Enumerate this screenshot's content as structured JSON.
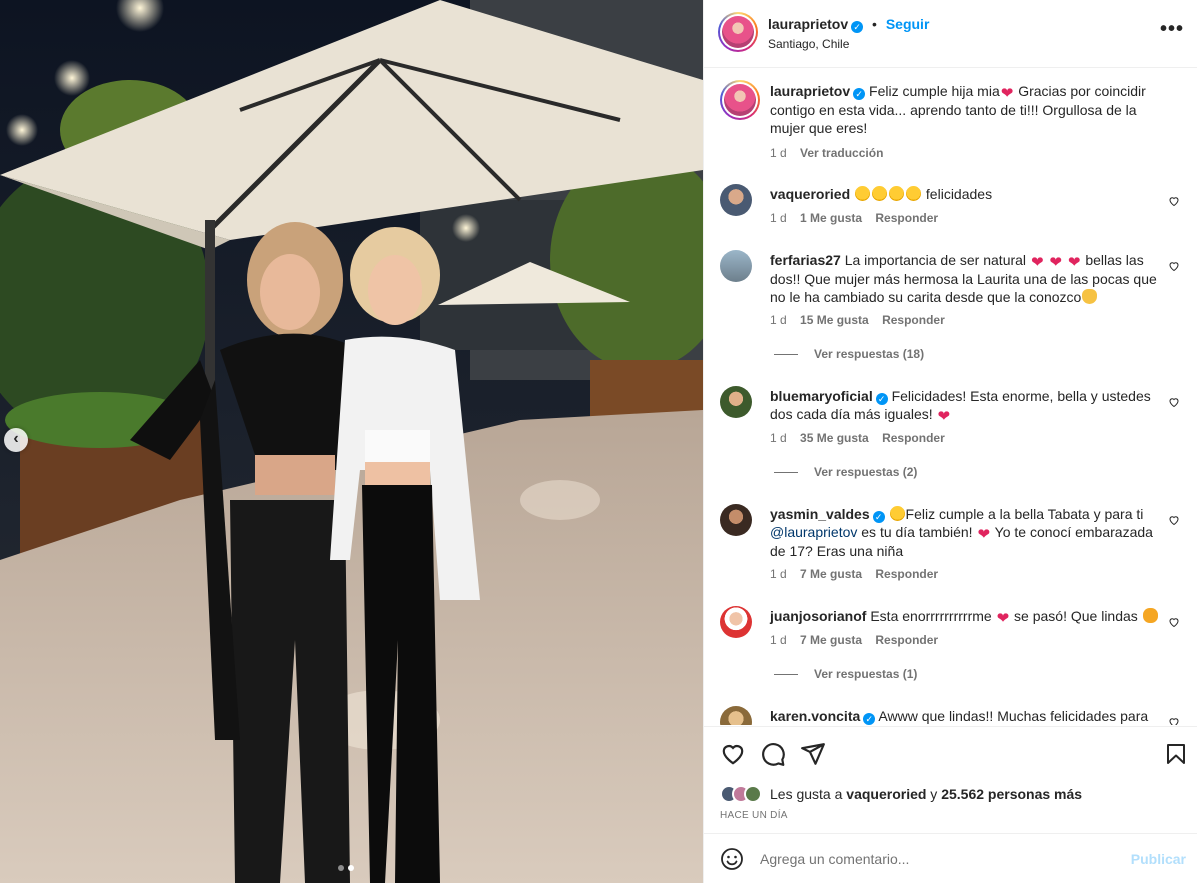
{
  "post_author": {
    "username": "lauraprietov",
    "follow_label": "Seguir",
    "location": "Santiago, Chile",
    "more_label": "•••"
  },
  "caption": {
    "username": "lauraprietov",
    "text_before_emoji": "Feliz cumple hija mia",
    "text_after_emoji": " Gracias por coincidir contigo en esta vida... aprendo tanto de ti!!! Orgullosa de la mujer que eres!",
    "time": "1 d",
    "translate_label": "Ver traducción"
  },
  "comments": [
    {
      "username": "vaqueroried",
      "text": " felicidades",
      "time": "1 d",
      "likes": "1 Me gusta",
      "reply_label": "Responder"
    },
    {
      "username": "ferfarias27",
      "text_a": "La importancia de ser natural ",
      "text_b": " bellas las dos!! Que mujer más hermosa la Laurita una de las pocas que no le ha cambiado su carita desde que la conozco",
      "time": "1 d",
      "likes": "15 Me gusta",
      "reply_label": "Responder",
      "replies_label": "Ver respuestas (18)"
    },
    {
      "username": "bluemaryoficial",
      "text": "Felicidades! Esta enorme, bella y ustedes dos cada día más iguales! ",
      "time": "1 d",
      "likes": "35 Me gusta",
      "reply_label": "Responder",
      "replies_label": "Ver respuestas (2)"
    },
    {
      "username": "yasmin_valdes",
      "text_a": "Feliz cumple a la bella Tabata y para ti ",
      "mention": "@lauraprietov",
      "text_b": " es tu día también! ",
      "text_c": " Yo te conocí embarazada de 17? Eras una niña",
      "time": "1 d",
      "likes": "7 Me gusta",
      "reply_label": "Responder"
    },
    {
      "username": "juanjosorianof",
      "text_a": "Esta enorrrrrrrrrrme ",
      "text_b": " se pasó! Que lindas ",
      "time": "1 d",
      "likes": "7 Me gusta",
      "reply_label": "Responder",
      "replies_label": "Ver respuestas (1)"
    },
    {
      "username": "karen.voncita",
      "text": "Awww que lindas!! Muchas felicidades para"
    }
  ],
  "likes_line": {
    "prefix": "Les gusta a ",
    "user": "vaqueroried",
    "middle": " y ",
    "count": "25.562 personas más"
  },
  "posted_ago": "HACE UN DÍA",
  "add_comment": {
    "placeholder": "Agrega un comentario...",
    "publish_label": "Publicar"
  },
  "carousel": {
    "total": 2,
    "active_index": 1
  },
  "colors": {
    "link_blue": "#0095f6",
    "muted": "#737373",
    "heart_red": "#e0245e",
    "publish_disabled": "#b2dffc"
  }
}
